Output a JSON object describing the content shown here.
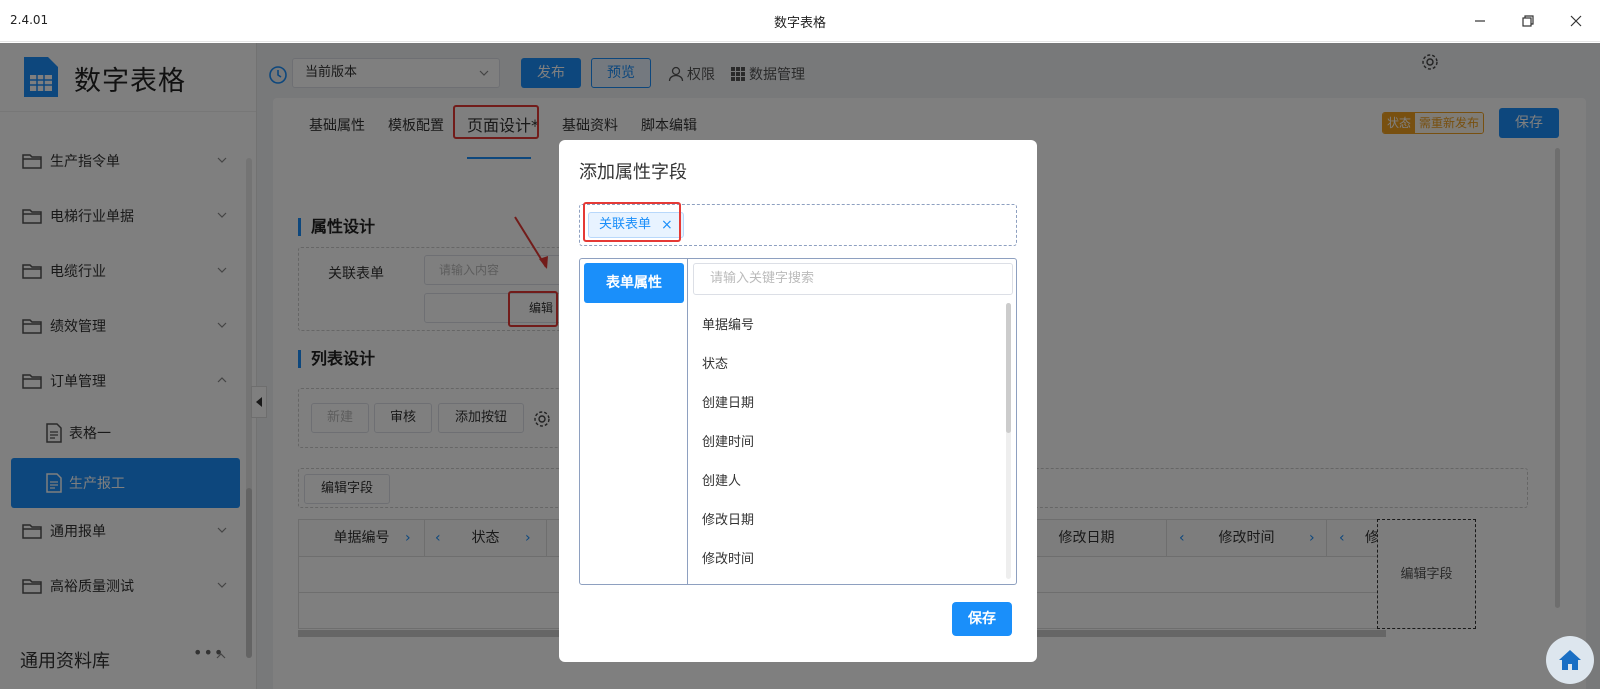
{
  "window": {
    "version": "2.4.01",
    "title": "数字表格"
  },
  "sidebar": {
    "app_name": "数字表格",
    "items": [
      {
        "label": "生产指令单",
        "expanded": false
      },
      {
        "label": "电梯行业单据",
        "expanded": false
      },
      {
        "label": "电缆行业",
        "expanded": false
      },
      {
        "label": "绩效管理",
        "expanded": false
      },
      {
        "label": "订单管理",
        "expanded": true
      },
      {
        "label": "通用报单",
        "expanded": false
      },
      {
        "label": "高裕质量测试",
        "expanded": false
      }
    ],
    "sub_items": [
      {
        "label": "表格一",
        "active": false
      },
      {
        "label": "生产报工",
        "active": true
      }
    ],
    "library_title": "通用资料库",
    "library_more": "•••"
  },
  "toolbar": {
    "version_select": "当前版本",
    "publish": "发布",
    "preview": "预览",
    "permissions": "权限",
    "data_management": "数据管理"
  },
  "tabs": [
    {
      "label": "基础属性"
    },
    {
      "label": "模板配置"
    },
    {
      "label": "页面设计*",
      "active": true
    },
    {
      "label": "基础资料"
    },
    {
      "label": "脚本编辑"
    }
  ],
  "status": {
    "key": "状态",
    "value": "需重新发布"
  },
  "save_top": "保存",
  "attr_design": {
    "title": "属性设计",
    "related_form_label": "关联表单",
    "related_form_placeholder": "请输入内容",
    "edit_partial": "编辑"
  },
  "list_design": {
    "title": "列表设计",
    "btn_new": "新建",
    "btn_review": "审核",
    "btn_add": "添加按钮",
    "edit_fields": "编辑字段",
    "columns": [
      "单据编号",
      "状态",
      "修改日期",
      "修改时间",
      "修"
    ],
    "edit_field_cell": "编辑字段"
  },
  "dialog": {
    "title": "添加属性字段",
    "selected_chip": "关联表单",
    "category": "表单属性",
    "search_placeholder": "请输入关键字搜索",
    "options": [
      "单据编号",
      "状态",
      "创建日期",
      "创建时间",
      "创建人",
      "修改日期",
      "修改时间"
    ],
    "save": "保存"
  },
  "colors": {
    "accent": "#1a8ffa",
    "warning": "#f0a020",
    "highlight": "#e53935"
  }
}
